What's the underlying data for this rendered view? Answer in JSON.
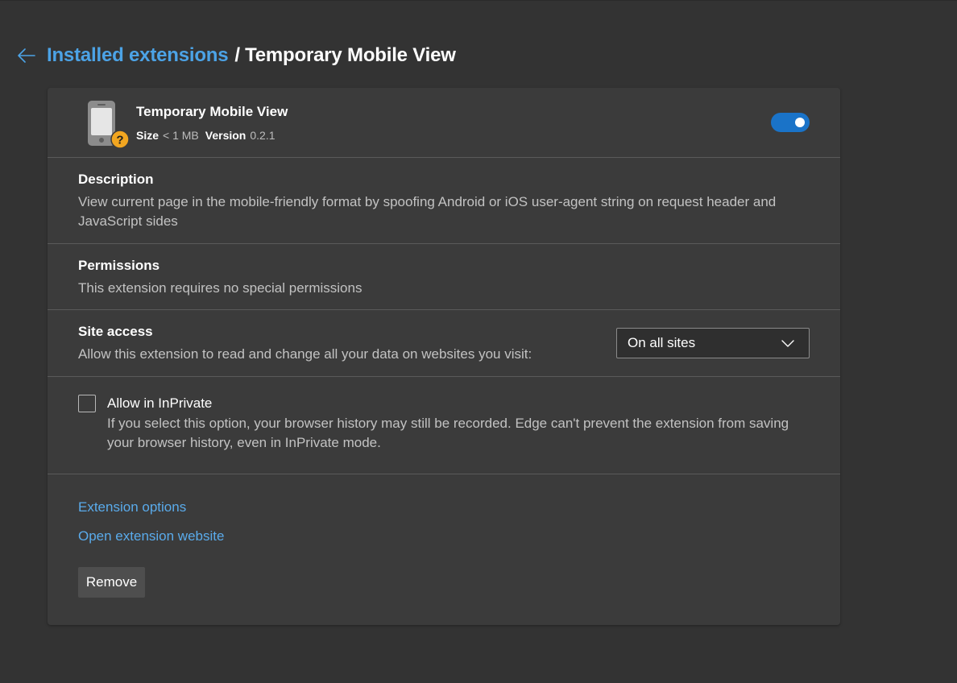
{
  "header": {
    "back_icon": "arrow-left-icon",
    "breadcrumb_link": "Installed extensions",
    "separator": "/",
    "current": "Temporary Mobile View"
  },
  "extension": {
    "icon": "mobile-phone-icon",
    "badge_icon": "question-mark-icon",
    "name": "Temporary Mobile View",
    "size_label": "Size",
    "size_value": "< 1 MB",
    "version_label": "Version",
    "version_value": "0.2.1",
    "enabled": true,
    "accent_color": "#1a73c8"
  },
  "description": {
    "title": "Description",
    "line1": "View current page in the mobile-friendly format by spoofing Android or iOS user-agent string on request header and",
    "line2": "JavaScript sides"
  },
  "permissions": {
    "title": "Permissions",
    "text": "This extension requires no special permissions"
  },
  "site_access": {
    "title": "Site access",
    "text": "Allow this extension to read and change all your data on websites you visit:",
    "selected": "On all sites"
  },
  "inprivate": {
    "label": "Allow in InPrivate",
    "checked": false,
    "help_line1": "If you select this option, your browser history may still be recorded. Edge can't prevent the extension from saving",
    "help_line2": "your browser history, even in InPrivate mode."
  },
  "links": {
    "options": "Extension options",
    "website": "Open extension website"
  },
  "remove_label": "Remove"
}
